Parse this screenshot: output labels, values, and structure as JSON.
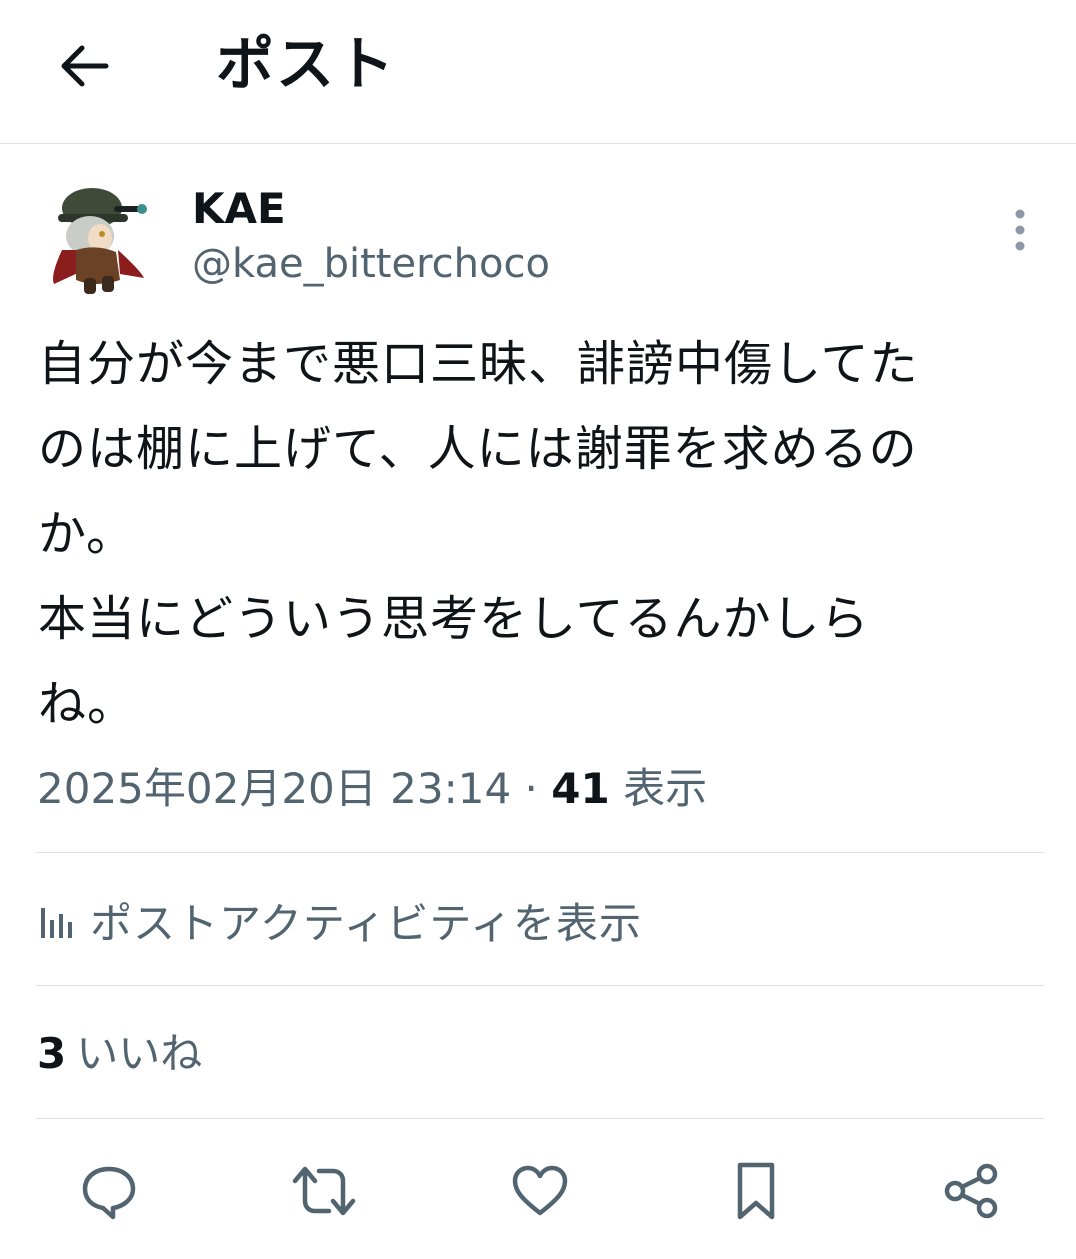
{
  "header": {
    "title": "ポスト",
    "back_icon": "arrow-left-icon"
  },
  "author": {
    "display_name": "KAE",
    "handle": "@kae_bitterchoco",
    "avatar": "avatar-illustration"
  },
  "post": {
    "lines": [
      "自分が今まで悪口三昧、誹謗中傷してた",
      "のは棚に上げて、人には謝罪を求めるの",
      "か。",
      "本当にどういう思考をしてるんかしら",
      "ね。"
    ],
    "timestamp": "2025年02月20日 23:14",
    "separator": "·",
    "views_count": "41",
    "views_label": "表示"
  },
  "activity": {
    "label": "ポストアクティビティを表示",
    "icon": "analytics-bar-icon"
  },
  "likes": {
    "count": "3",
    "label": "いいね"
  },
  "actions": [
    {
      "name": "reply",
      "icon": "reply-bubble-icon"
    },
    {
      "name": "repost",
      "icon": "repost-arrows-icon"
    },
    {
      "name": "like",
      "icon": "heart-icon"
    },
    {
      "name": "bookmark",
      "icon": "bookmark-icon"
    },
    {
      "name": "share",
      "icon": "share-icon"
    }
  ],
  "colors": {
    "text": "#0f1419",
    "secondary": "#536471",
    "divider": "#dfe3e6",
    "icon": "#536471"
  }
}
